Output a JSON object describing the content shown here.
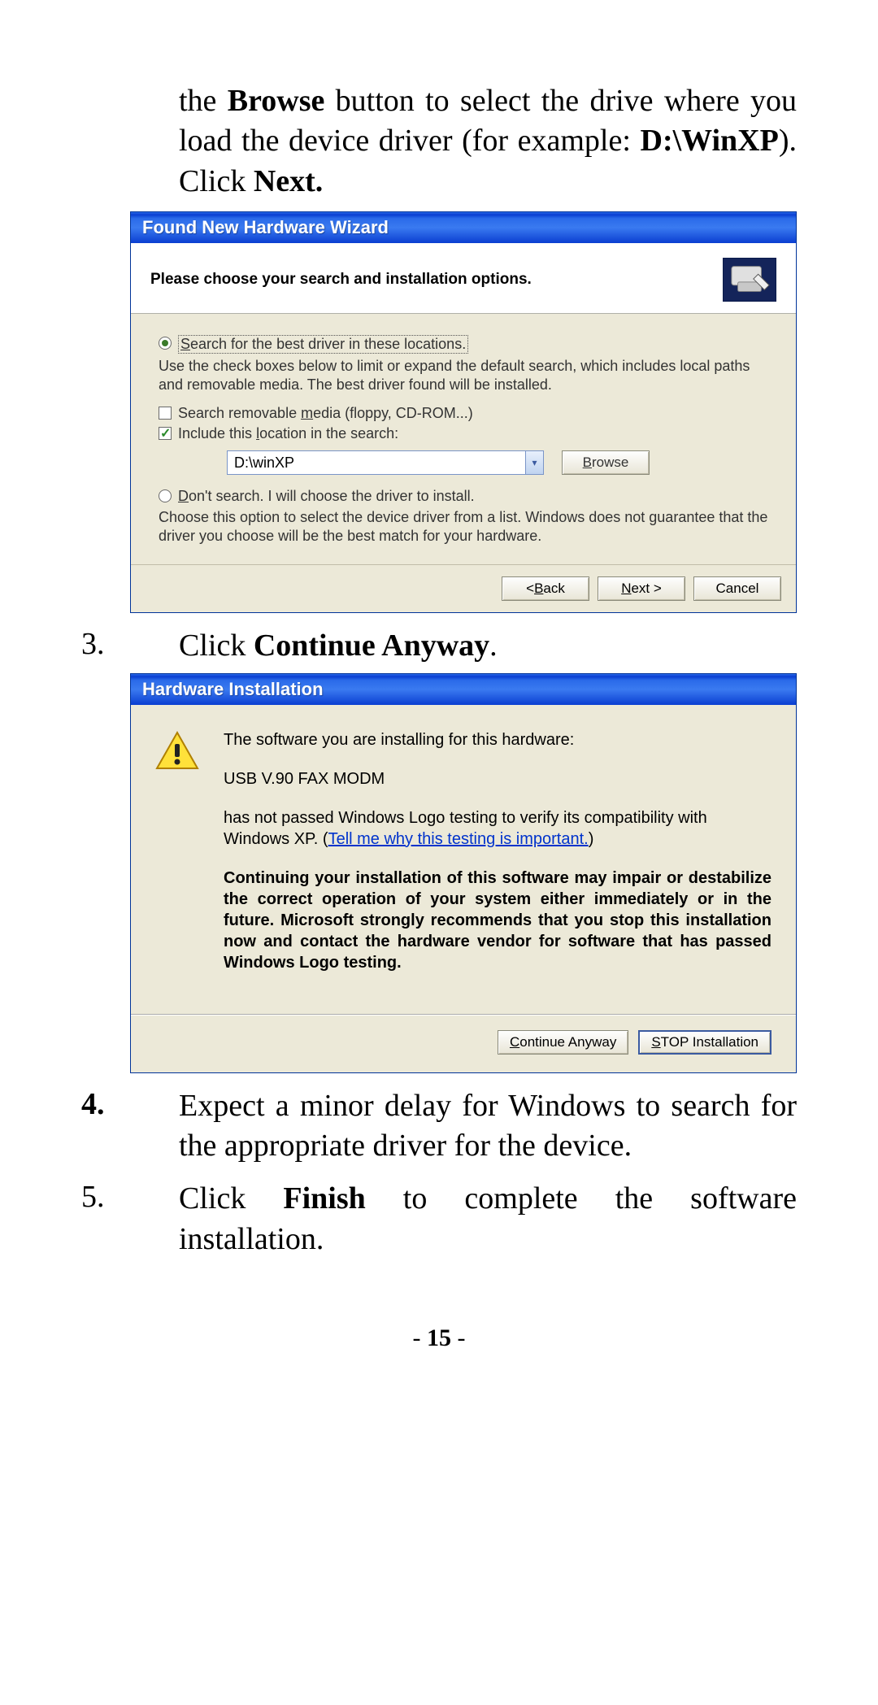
{
  "intro": {
    "pre": "the ",
    "browse": "Browse",
    "mid1": " button to select the drive where you load the device driver (for example: ",
    "path": "D:\\WinXP",
    "mid2": ").  Click ",
    "next": "Next."
  },
  "wizard": {
    "title": "Found New Hardware Wizard",
    "header": "Please choose your search and installation options.",
    "opt1_label_dotted": "Search for the best driver in these locations.",
    "opt1_u": "S",
    "opt1_rest": "earch for the best driver in these locations.",
    "opt1_desc": "Use the check boxes below to limit or expand the default search, which includes local paths and removable media. The best driver found will be installed.",
    "chk_removable_u": "m",
    "chk_removable_pre": "Search removable ",
    "chk_removable_post": "edia (floppy, CD-ROM...)",
    "chk_include_pre": "Include this ",
    "chk_include_u": "l",
    "chk_include_post": "ocation in the search:",
    "combo_value": "D:\\winXP",
    "browse_u": "B",
    "browse_rest": "rowse",
    "opt2_u": "D",
    "opt2_rest": "on't search. I will choose the driver to install.",
    "opt2_desc": "Choose this option to select the device driver from a list.  Windows does not guarantee that the driver you choose will be the best match for your hardware.",
    "back_u": "B",
    "back_pre": "< ",
    "back_rest": "ack",
    "next_u": "N",
    "next_rest": "ext >",
    "cancel": "Cancel"
  },
  "step3": {
    "num": "3.",
    "pre": "Click ",
    "b": "Continue Anyway",
    "post": "."
  },
  "hw": {
    "title": "Hardware Installation",
    "line1": "The software you are installing for this hardware:",
    "device": "USB V.90 FAX MODM",
    "line2_pre": "has not passed Windows Logo testing to verify its compatibility with Windows XP. (",
    "link": "Tell me why this testing is important.",
    "line2_post": ")",
    "strong": "Continuing your installation of this software may impair or destabilize the correct operation of your system either immediately or in the future. Microsoft strongly recommends that you stop this installation now and contact the hardware vendor for software that has passed Windows Logo testing.",
    "continue_u": "C",
    "continue_rest": "ontinue Anyway",
    "stop_u": "S",
    "stop_rest": "TOP Installation"
  },
  "step4": {
    "num": "4.",
    "txt": "Expect a minor delay for Windows to search for the appropriate driver for the device."
  },
  "step5": {
    "num": "5.",
    "pre": "Click ",
    "b": "Finish",
    "post": " to complete the software installation."
  },
  "pagenum": {
    "dash1": "- ",
    "num": "15",
    "dash2": " -"
  }
}
